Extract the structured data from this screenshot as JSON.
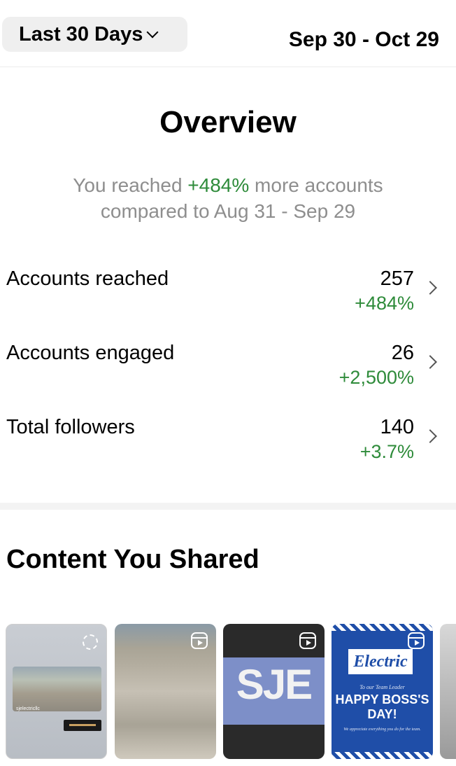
{
  "header": {
    "range_label": "Last 30 Days",
    "date_range": "Sep 30 - Oct 29"
  },
  "overview": {
    "title": "Overview",
    "summary_prefix": "You reached ",
    "summary_pct": "+484%",
    "summary_suffix": " more accounts compared to Aug 31 - Sep 29"
  },
  "metrics": [
    {
      "label": "Accounts reached",
      "value": "257",
      "delta": "+484%"
    },
    {
      "label": "Accounts engaged",
      "value": "26",
      "delta": "+2,500%"
    },
    {
      "label": "Total followers",
      "value": "140",
      "delta": "+3.7%"
    }
  ],
  "content": {
    "title": "Content You Shared",
    "items": [
      {
        "type": "story",
        "tag": "sjelectricllc"
      },
      {
        "type": "reel",
        "icon": "reels-icon"
      },
      {
        "type": "reel",
        "icon": "reels-icon",
        "overlay_text": "SJE"
      },
      {
        "type": "reel",
        "icon": "reels-icon",
        "logo": "Electric",
        "line1": "To our Team Leader",
        "headline": "HAPPY BOSS'S DAY!",
        "line2": "We appreciate everything you do for the team."
      },
      {
        "type": "post"
      }
    ]
  },
  "colors": {
    "positive": "#2e8b3a",
    "muted": "#8e8e8e",
    "pill_bg": "#efefef"
  }
}
